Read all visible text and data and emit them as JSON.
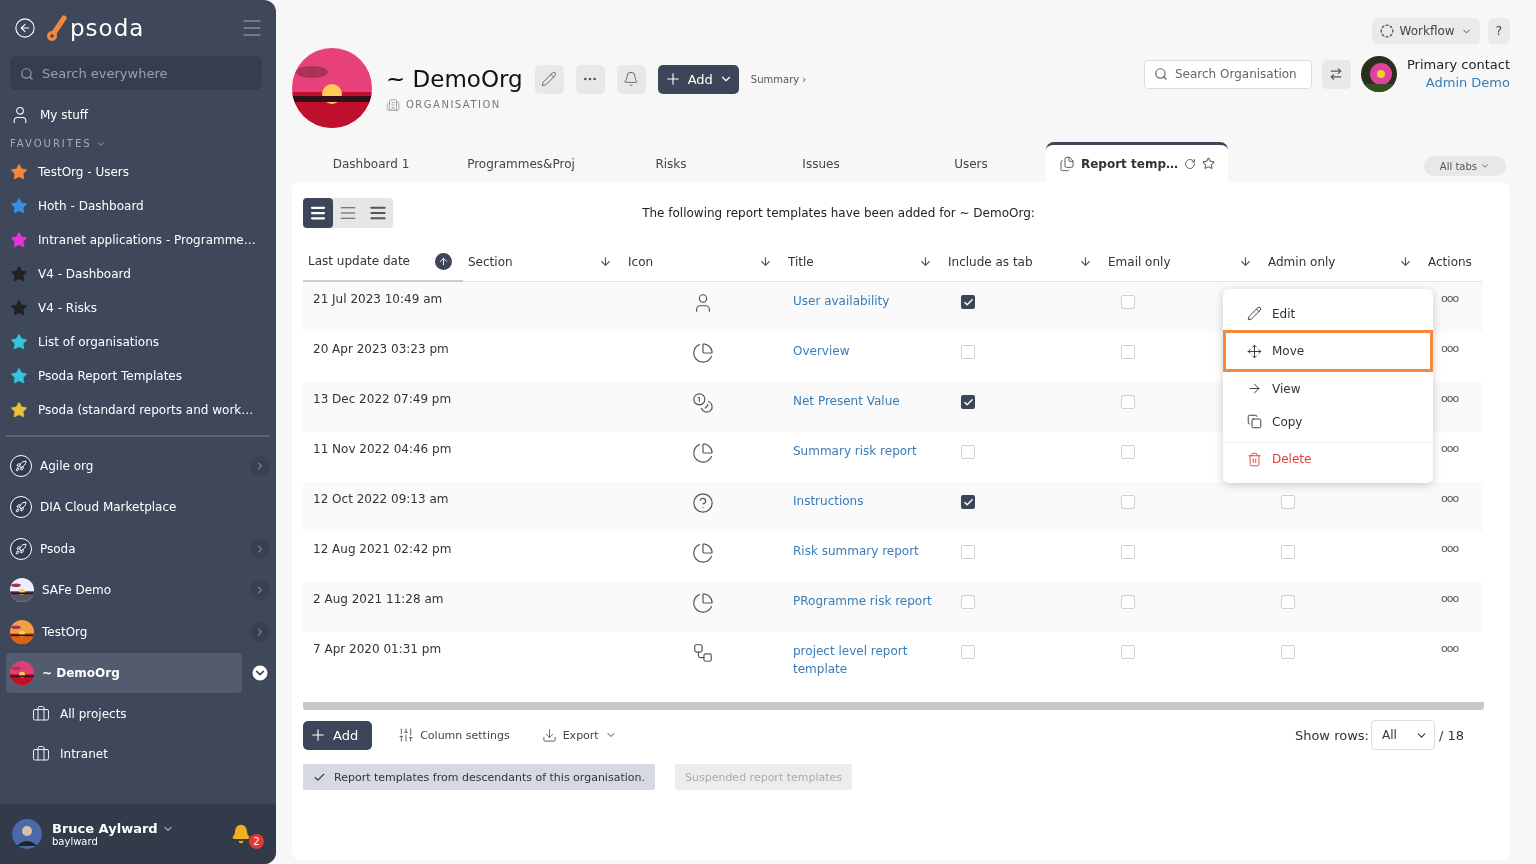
{
  "sidebar": {
    "logo": "psoda",
    "search": {
      "placeholder": "Search everywhere"
    },
    "my_stuff": "My stuff",
    "favourites_heading": "FAVOURITES",
    "favourites": [
      {
        "label": "TestOrg - Users",
        "color": "#f5883a"
      },
      {
        "label": "Hoth - Dashboard",
        "color": "#3a8ee6"
      },
      {
        "label": "Intranet applications - Programme…",
        "color": "#e535d8"
      },
      {
        "label": "V4 - Dashboard",
        "color": "#222222"
      },
      {
        "label": "V4 - Risks",
        "color": "#222222"
      },
      {
        "label": "List of organisations",
        "color": "#35c4e0"
      },
      {
        "label": "Psoda Report Templates",
        "color": "#35c4e0"
      },
      {
        "label": "Psoda (standard reports and work…",
        "color": "#e8c03a"
      }
    ],
    "organisations": [
      {
        "label": "Agile org",
        "kind": "rocket",
        "has_children": true,
        "selected": false,
        "expanded": false
      },
      {
        "label": "DIA Cloud Marketplace",
        "kind": "rocket",
        "has_children": false,
        "selected": false,
        "expanded": false
      },
      {
        "label": "Psoda",
        "kind": "rocket",
        "has_children": true,
        "selected": false,
        "expanded": false
      },
      {
        "label": "SAFe Demo",
        "kind": "picture",
        "has_children": true,
        "selected": false,
        "expanded": false
      },
      {
        "label": "TestOrg",
        "kind": "picture",
        "has_children": true,
        "selected": false,
        "expanded": false
      },
      {
        "label": "~ DemoOrg",
        "kind": "picture",
        "has_children": true,
        "selected": true,
        "expanded": true,
        "children": [
          "All projects",
          "Intranet"
        ]
      }
    ],
    "user": {
      "name": "Bruce Aylward",
      "username": "baylward",
      "notifications": "2"
    }
  },
  "top_bar": {
    "workflow": "Workflow",
    "help": "?"
  },
  "header": {
    "title": "~ DemoOrg",
    "type": "ORGANISATION",
    "add": "Add",
    "summary": "Summary ›",
    "search": {
      "placeholder": "Search Organisation"
    },
    "contact_label": "Primary contact",
    "contact_name": "Admin Demo"
  },
  "tabs": [
    {
      "label": "Dashboard 1",
      "selected": false
    },
    {
      "label": "Programmes&Proj",
      "selected": false
    },
    {
      "label": "Risks",
      "selected": false
    },
    {
      "label": "Issues",
      "selected": false
    },
    {
      "label": "Users",
      "selected": false
    },
    {
      "label": "Report temp…",
      "selected": true
    }
  ],
  "all_tabs": "All tabs",
  "view_modes": [
    {
      "selected": true
    },
    {
      "selected": false
    },
    {
      "selected": false
    }
  ],
  "intro": "The following report templates have been added for ~ DemoOrg:",
  "table": {
    "columns": [
      {
        "label": "Last update date",
        "sorted": true
      },
      {
        "label": "Section",
        "sorted": false
      },
      {
        "label": "Icon",
        "sorted": false
      },
      {
        "label": "Title",
        "sorted": false
      },
      {
        "label": "Include as tab",
        "sorted": false
      },
      {
        "label": "Email only",
        "sorted": false
      },
      {
        "label": "Admin only",
        "sorted": false
      },
      {
        "label": "Actions"
      }
    ],
    "rows": [
      {
        "date": "21 Jul 2023 10:49 am",
        "kind": "user",
        "title": "User availability",
        "include_as_tab": true,
        "email_only": false,
        "actions": "ooo"
      },
      {
        "date": "20 Apr 2023 03:23 pm",
        "kind": "pie",
        "title": "Overview",
        "include_as_tab": false,
        "email_only": false,
        "actions": "ooo"
      },
      {
        "date": "13 Dec 2022 07:49 pm",
        "kind": "coins",
        "title": "Net Present Value",
        "include_as_tab": true,
        "email_only": false,
        "actions": "ooo"
      },
      {
        "date": "11 Nov 2022 04:46 pm",
        "kind": "pie",
        "title": "Summary risk report",
        "include_as_tab": false,
        "email_only": false,
        "actions": "ooo"
      },
      {
        "date": "12 Oct 2022 09:13 am",
        "kind": "question",
        "title": "Instructions",
        "include_as_tab": true,
        "email_only": false,
        "admin_only": false,
        "actions": "ooo"
      },
      {
        "date": "12 Aug 2021 02:42 pm",
        "kind": "pie",
        "title": "Risk summary report",
        "include_as_tab": false,
        "email_only": false,
        "admin_only": false,
        "actions": "ooo"
      },
      {
        "date": "2 Aug 2021 11:28 am",
        "kind": "pie",
        "title": "PRogramme risk report",
        "include_as_tab": false,
        "email_only": false,
        "admin_only": false,
        "actions": "ooo"
      },
      {
        "date": "7 Apr 2020 01:31 pm",
        "kind": "flow",
        "title": "project level report template",
        "include_as_tab": false,
        "email_only": false,
        "admin_only": false,
        "actions": "ooo"
      }
    ]
  },
  "action_menu": [
    {
      "label": "Edit",
      "kind": "edit",
      "selected": false
    },
    {
      "label": "Move",
      "kind": "move",
      "selected": true
    },
    {
      "label": "View",
      "kind": "view",
      "selected": false
    },
    {
      "label": "Copy",
      "kind": "copy",
      "selected": false
    },
    {
      "label": "Delete",
      "kind": "delete",
      "selected": false
    }
  ],
  "footer": {
    "add": "Add",
    "column_settings": "Column settings",
    "export": "Export",
    "show_rows_label": "Show rows:",
    "show_rows": "All",
    "total": "/ 18",
    "filters": [
      {
        "label": "Report templates from descendants of this organisation.",
        "on": true
      },
      {
        "label": "Suspended report templates",
        "on": false
      }
    ]
  }
}
